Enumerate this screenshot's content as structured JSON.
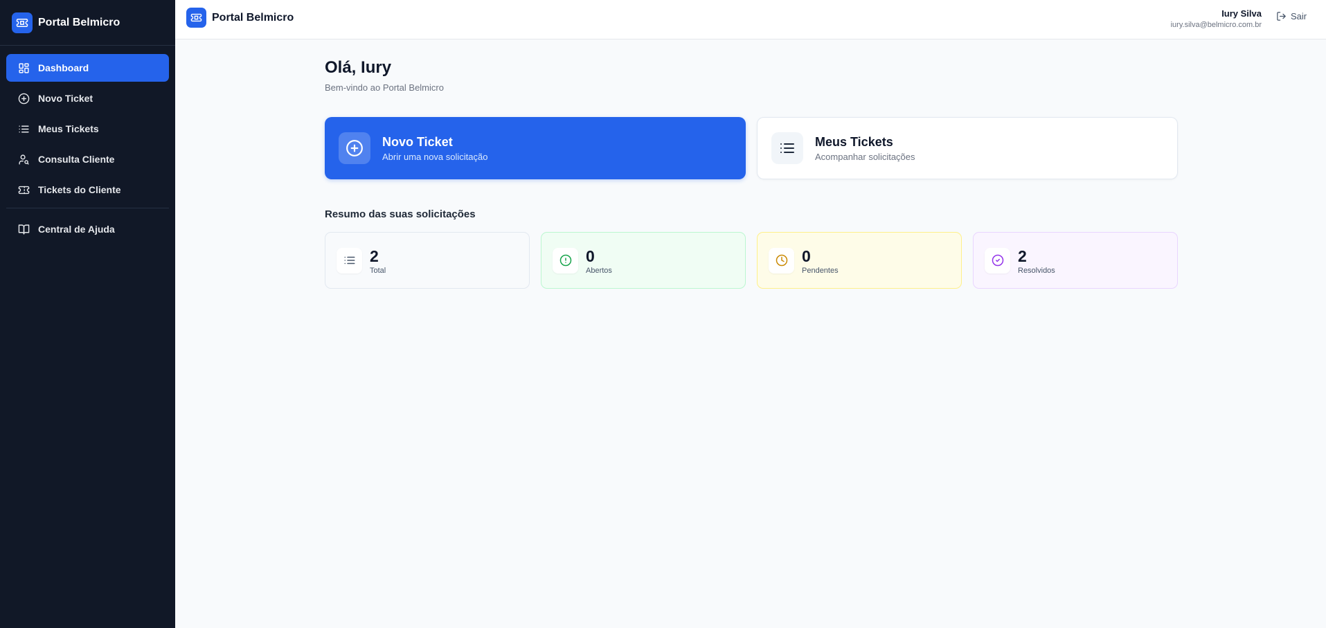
{
  "app": {
    "name": "Portal Belmicro"
  },
  "sidebar": {
    "brand": "Portal Belmicro",
    "items": [
      {
        "label": "Dashboard",
        "icon": "dashboard-icon",
        "active": true
      },
      {
        "label": "Novo Ticket",
        "icon": "plus-circle-icon"
      },
      {
        "label": "Meus Tickets",
        "icon": "list-icon"
      },
      {
        "label": "Consulta Cliente",
        "icon": "user-search-icon"
      },
      {
        "label": "Tickets do Cliente",
        "icon": "ticket-icon"
      }
    ],
    "help": {
      "label": "Central de Ajuda",
      "icon": "book-icon"
    }
  },
  "header": {
    "brand": "Portal Belmicro",
    "user_name": "Iury Silva",
    "user_email": "iury.silva@belmicro.com.br",
    "logout_label": "Sair"
  },
  "main": {
    "greeting": "Olá, Iury",
    "welcome": "Bem-vindo ao Portal Belmicro",
    "actions": [
      {
        "title": "Novo Ticket",
        "subtitle": "Abrir uma nova solicitação",
        "icon": "plus-circle-icon"
      },
      {
        "title": "Meus Tickets",
        "subtitle": "Acompanhar solicitações",
        "icon": "list-icon"
      }
    ],
    "summary_title": "Resumo das suas solicitações",
    "stats": [
      {
        "value": "2",
        "label": "Total",
        "icon": "list-icon",
        "color": "#475569",
        "bg": "#f8fafc",
        "border": "#e2e8f0"
      },
      {
        "value": "0",
        "label": "Abertos",
        "icon": "alert-circle-icon",
        "color": "#16a34a",
        "bg": "#f0fdf4",
        "border": "#bbf7d0"
      },
      {
        "value": "0",
        "label": "Pendentes",
        "icon": "clock-icon",
        "color": "#ca8a04",
        "bg": "#fefce8",
        "border": "#fef08a"
      },
      {
        "value": "2",
        "label": "Resolvidos",
        "icon": "check-circle-icon",
        "color": "#9333ea",
        "bg": "#faf5ff",
        "border": "#e9d5ff"
      }
    ]
  },
  "colors": {
    "primary": "#2563eb",
    "sidebar_bg": "#111827"
  }
}
